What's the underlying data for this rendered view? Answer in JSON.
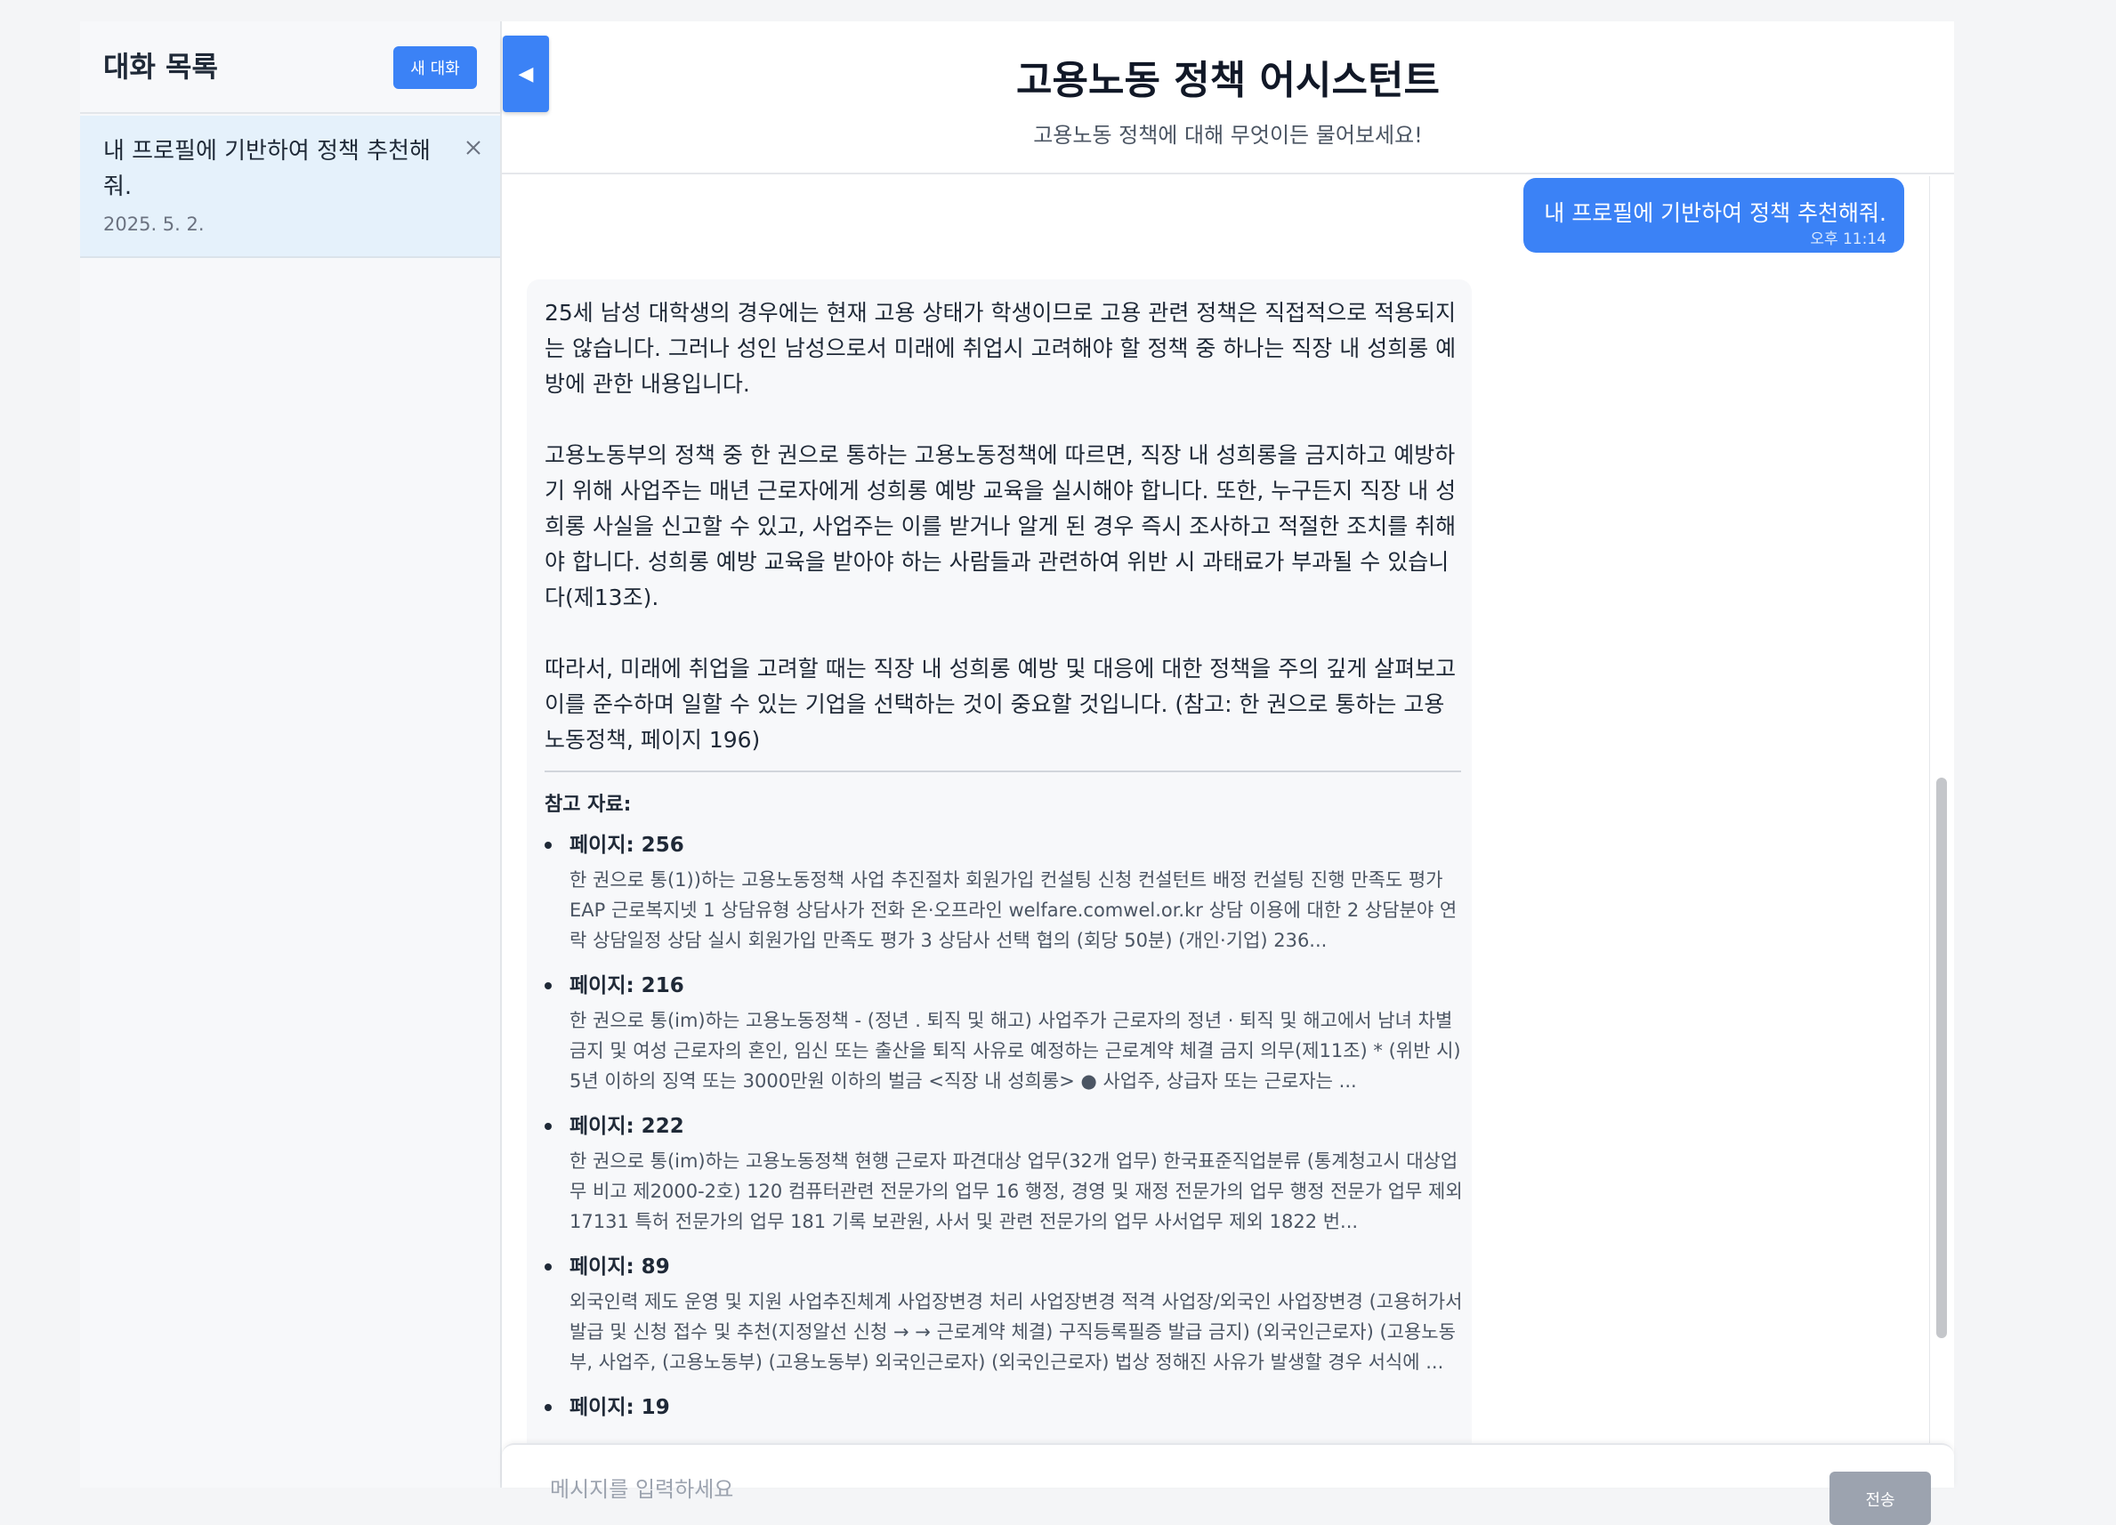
{
  "sidebar": {
    "title": "대화 목록",
    "new_chat_label": "새 대화",
    "conversations": [
      {
        "title": "내 프로필에 기반하여 정책 추천해줘.",
        "date": "2025. 5. 2."
      }
    ]
  },
  "header": {
    "toggle_label": "◀",
    "title": "고용노동 정책 어시스턴트",
    "subtitle": "고용노동 정책에 대해 무엇이든 물어보세요!"
  },
  "chat": {
    "user_message": {
      "text": "내 프로필에 기반하여 정책 추천해줘.",
      "time": "오후 11:14"
    },
    "assistant_message": {
      "paragraphs": [
        "25세 남성 대학생의 경우에는 현재 고용 상태가 학생이므로 고용 관련 정책은 직접적으로 적용되지는 않습니다. 그러나 성인 남성으로서 미래에 취업시 고려해야 할 정책 중 하나는 직장 내 성희롱 예방에 관한 내용입니다.",
        "고용노동부의 정책 중 한 권으로 통하는 고용노동정책에 따르면, 직장 내 성희롱을 금지하고 예방하기 위해 사업주는 매년 근로자에게 성희롱 예방 교육을 실시해야 합니다. 또한, 누구든지 직장 내 성희롱 사실을 신고할 수 있고, 사업주는 이를 받거나 알게 된 경우 즉시 조사하고 적절한 조치를 취해야 합니다. 성희롱 예방 교육을 받아야 하는 사람들과 관련하여 위반 시 과태료가 부과될 수 있습니다(제13조).",
        "따라서, 미래에 취업을 고려할 때는 직장 내 성희롱 예방 및 대응에 대한 정책을 주의 깊게 살펴보고 이를 준수하며 일할 수 있는 기업을 선택하는 것이 중요할 것입니다. (참고: 한 권으로 통하는 고용노동정책, 페이지 196)"
      ],
      "references_heading": "참고 자료:",
      "references": [
        {
          "page": "페이지: 256",
          "excerpt": "한 권으로 통(1))하는 고용노동정책 사업 추진절차 회원가입 컨설팅 신청 컨설턴트 배정 컨설팅 진행 만족도 평가 EAP 근로복지넷 1 상담유형 상담사가 전화 온·오프라인 welfare.comwel.or.kr 상담 이용에 대한 2 상담분야 연락 상담일정 상담 실시 회원가입 만족도 평가 3 상담사 선택 협의 (회당 50분) (개인·기업) 236..."
        },
        {
          "page": "페이지: 216",
          "excerpt": "한 권으로 통(im)하는 고용노동정책 - (정년 . 퇴직 및 해고) 사업주가 근로자의 정년 · 퇴직 및 해고에서 남녀 차별 금지 및 여성 근로자의 혼인, 임신 또는 출산을 퇴직 사유로 예정하는 근로계약 체결 금지 의무(제11조) * (위반 시) 5년 이하의 징역 또는 3000만원 이하의 벌금 <직장 내 성희롱> ● 사업주, 상급자 또는 근로자는 ..."
        },
        {
          "page": "페이지: 222",
          "excerpt": "한 권으로 통(im)하는 고용노동정책 현행 근로자 파견대상 업무(32개 업무) 한국표준직업분류 (통계청고시 대상업무 비고 제2000-2호) 120 컴퓨터관련 전문가의 업무 16 행정, 경영 및 재정 전문가의 업무 행정 전문가 업무 제외 17131 특허 전문가의 업무 181 기록 보관원, 사서 및 관련 전문가의 업무 사서업무 제외 1822 번..."
        },
        {
          "page": "페이지: 89",
          "excerpt": "외국인력 제도 운영 및 지원 사업추진체계 사업장변경 처리 사업장변경 적격 사업장/외국인 사업장변경 (고용허가서 발급 및 신청 접수 및 추천(지정알선 신청 → → 근로계약 체결) 구직등록필증 발급 금지) (외국인근로자) (고용노동부, 사업주, (고용노동부) (고용노동부) 외국인근로자) (외국인근로자) 법상 정해진 사유가 발생할 경우 서식에 ..."
        },
        {
          "page": "페이지: 19",
          "excerpt": ""
        }
      ]
    }
  },
  "input": {
    "placeholder": "메시지를 입력하세요",
    "send_label": "전송"
  },
  "colors": {
    "accent": "#3b82f6",
    "sidebar_active_bg": "#e5f1fb",
    "send_disabled": "#9ca3af"
  }
}
